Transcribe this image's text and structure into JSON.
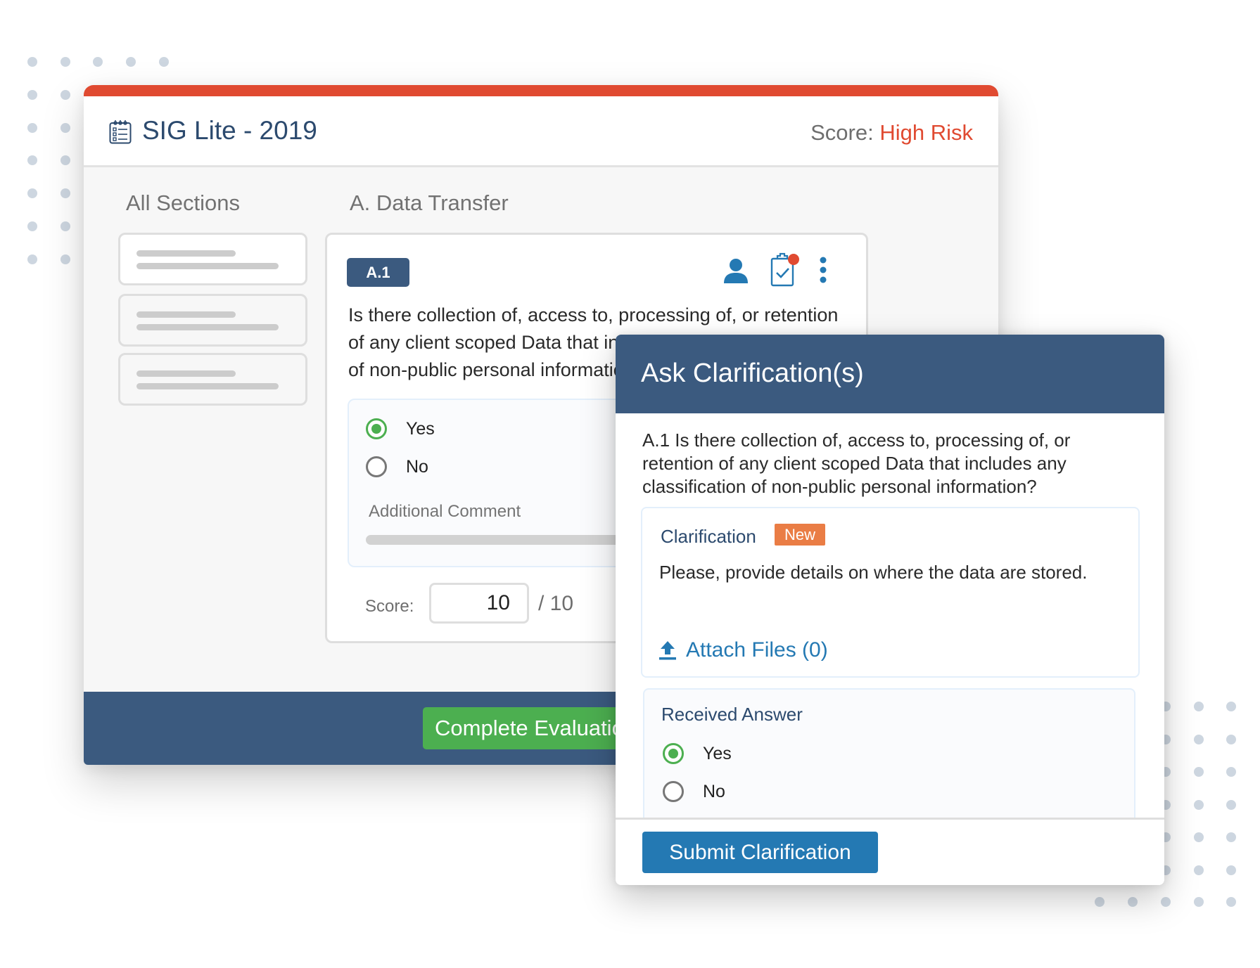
{
  "window": {
    "title": "SIG Lite - 2019",
    "title_icon": "checklist-icon",
    "score_label": "Score:",
    "score_value": "High Risk"
  },
  "colors": {
    "accent_red": "#e04a31",
    "navy": "#3b5a7f",
    "success_green": "#4caf50",
    "link_blue": "#2479b3",
    "new_badge_orange": "#ea7d45"
  },
  "sidebar": {
    "title": "All Sections",
    "items": [
      {
        "state": "active",
        "label": ""
      },
      {
        "state": "inactive",
        "label": ""
      },
      {
        "state": "inactive",
        "label": ""
      }
    ]
  },
  "section": {
    "heading": "A. Data Transfer",
    "question": {
      "id": "A.1",
      "text": "Is there collection of, access to, processing of, or retention of any client scoped Data that includes any classification of non-public personal information?",
      "actions": [
        "user-icon",
        "clipboard-check-icon",
        "more-vertical-icon"
      ],
      "has_notification": true,
      "options": [
        {
          "label": "Yes",
          "checked": true
        },
        {
          "label": "No",
          "checked": false
        }
      ],
      "comment_label": "Additional Comment",
      "score_label": "Score:",
      "score_value": "10",
      "score_max": "/ 10"
    }
  },
  "footer": {
    "complete_button": "Complete Evaluation"
  },
  "modal": {
    "title": "Ask Clarification(s)",
    "question_text": "A.1 Is there collection of, access to, processing of, or retention of any client scoped Data that includes any classification of non-public personal information?",
    "clarification": {
      "label": "Clarification",
      "badge": "New",
      "text": "Please, provide details on where the data are stored.",
      "attach_label": "Attach Files (0)",
      "attach_icon": "upload-icon"
    },
    "received": {
      "label": "Received Answer",
      "options": [
        {
          "label": "Yes",
          "checked": true
        },
        {
          "label": "No",
          "checked": false
        }
      ]
    },
    "submit_button": "Submit Clarification"
  }
}
